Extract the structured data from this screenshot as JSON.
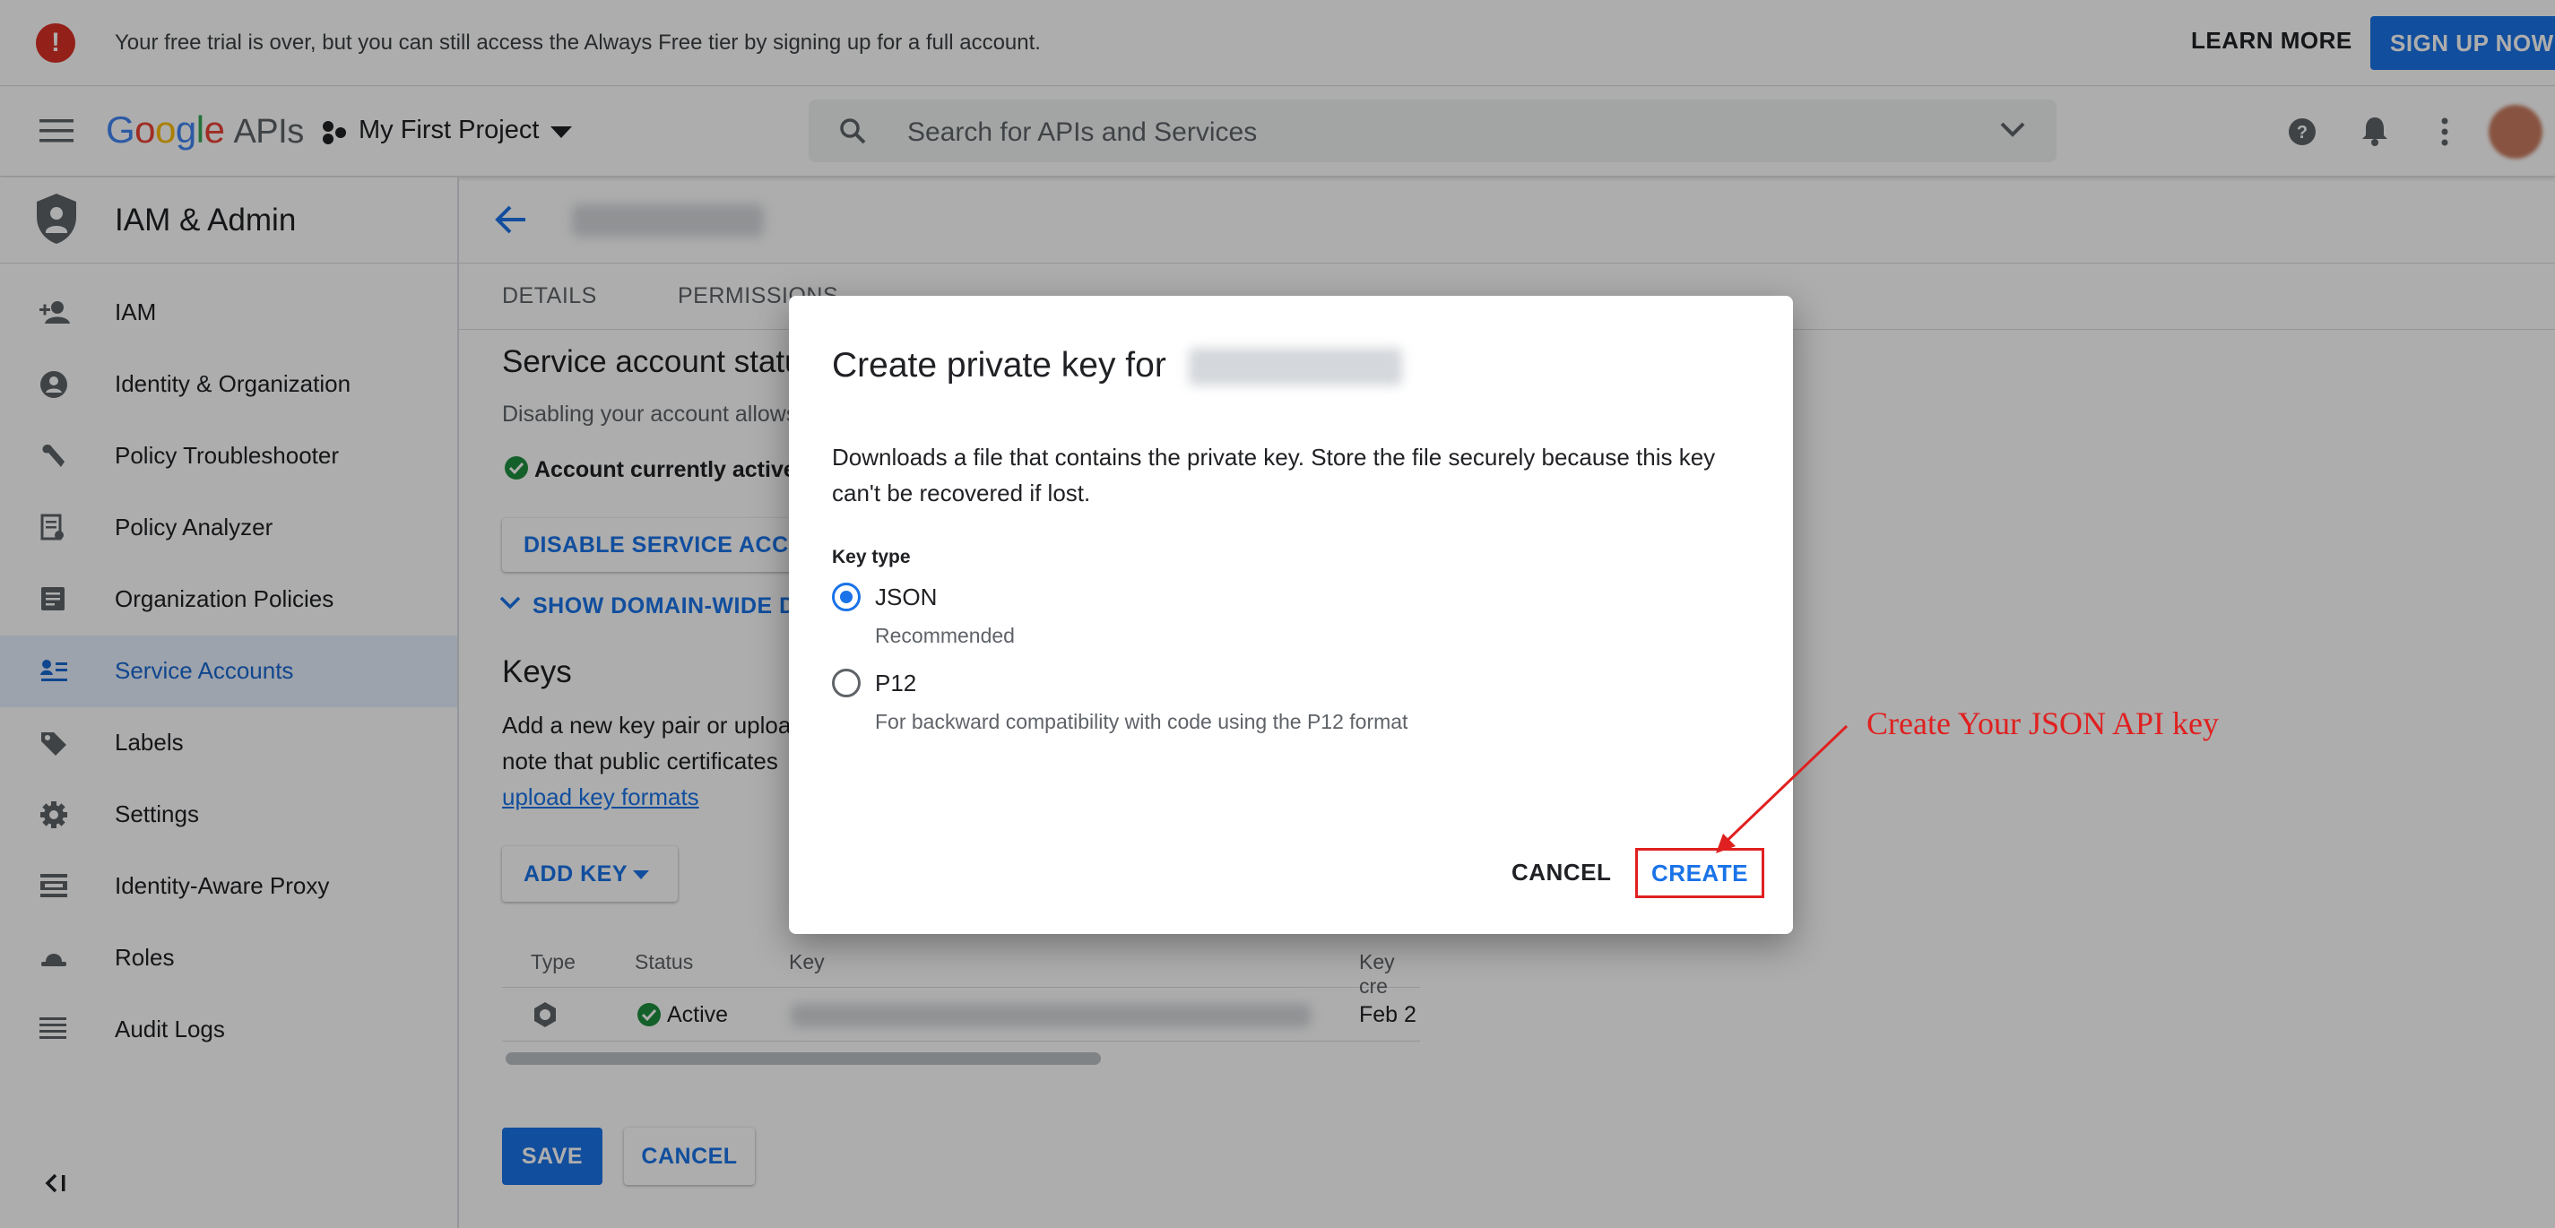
{
  "banner": {
    "message": "Your free trial is over, but you can still access the Always Free tier by signing up for a full account.",
    "learn_more": "LEARN MORE",
    "sign_up": "SIGN UP NOW"
  },
  "appbar": {
    "logo_google": "Google",
    "logo_apis": "APIs",
    "project": "My First Project",
    "search_placeholder": "Search for APIs and Services"
  },
  "sidebar": {
    "title": "IAM & Admin",
    "items": [
      {
        "label": "IAM",
        "icon": "person-add-icon"
      },
      {
        "label": "Identity & Organization",
        "icon": "account-circle-icon"
      },
      {
        "label": "Policy Troubleshooter",
        "icon": "wrench-icon"
      },
      {
        "label": "Policy Analyzer",
        "icon": "policy-doc-icon"
      },
      {
        "label": "Organization Policies",
        "icon": "list-doc-icon"
      },
      {
        "label": "Service Accounts",
        "icon": "service-account-icon",
        "active": true
      },
      {
        "label": "Labels",
        "icon": "label-icon"
      },
      {
        "label": "Settings",
        "icon": "gear-icon"
      },
      {
        "label": "Identity-Aware Proxy",
        "icon": "proxy-icon"
      },
      {
        "label": "Roles",
        "icon": "hat-icon"
      },
      {
        "label": "Audit Logs",
        "icon": "lines-icon"
      }
    ]
  },
  "main": {
    "tabs": [
      "DETAILS",
      "PERMISSIONS"
    ],
    "status_heading": "Service account status",
    "status_desc": "Disabling your account allows",
    "status_active": "Account currently active",
    "disable_button": "DISABLE SERVICE ACCOUNT",
    "show_domain": "SHOW DOMAIN-WIDE DELEGATION",
    "keys_heading": "Keys",
    "keys_desc_1": "Add a new key pair or upload",
    "keys_desc_2": "note that public certificates",
    "keys_link": "upload key formats",
    "add_key": "ADD KEY",
    "table": {
      "headers": [
        "Type",
        "Status",
        "Key",
        "Key cre"
      ],
      "rows": [
        {
          "status": "Active",
          "date": "Feb 2"
        }
      ]
    },
    "save": "SAVE",
    "cancel": "CANCEL"
  },
  "dialog": {
    "title": "Create private key for",
    "description": "Downloads a file that contains the private key. Store the file securely because this key can't be recovered if lost.",
    "key_type_label": "Key type",
    "options": [
      {
        "label": "JSON",
        "sub": "Recommended",
        "selected": true
      },
      {
        "label": "P12",
        "sub": "For backward compatibility with code using the P12 format",
        "selected": false
      }
    ],
    "cancel": "CANCEL",
    "create": "CREATE"
  },
  "annotation": {
    "text": "Create Your JSON API key",
    "color": "#e02020"
  },
  "colors": {
    "accent": "#1a73e8",
    "warning": "#d93025",
    "success": "#1e8e3e"
  }
}
